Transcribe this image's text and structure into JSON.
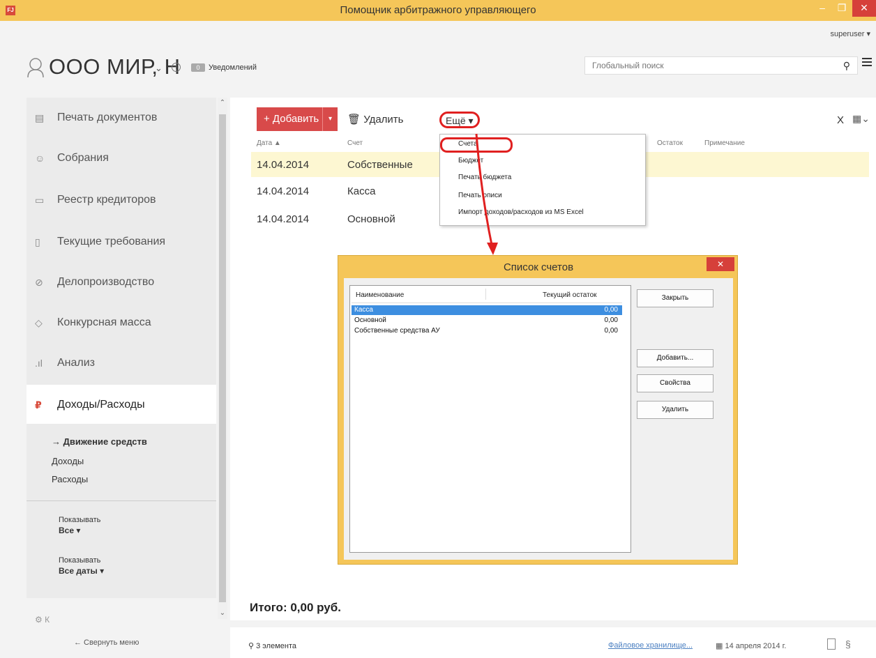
{
  "window": {
    "title": "Помощник арбитражного управляющего",
    "user": "superuser ▾"
  },
  "header": {
    "org_name": "ООО МИР, Н",
    "notifications_count": "0",
    "notifications_label": "Уведомлений",
    "search_placeholder": "Глобальный поиск"
  },
  "sidebar": {
    "items": [
      {
        "label": "Печать документов",
        "icon": "print-icon"
      },
      {
        "label": "Собрания",
        "icon": "meeting-icon"
      },
      {
        "label": "Реестр кредиторов",
        "icon": "registry-icon"
      },
      {
        "label": "Текущие требования",
        "icon": "requirements-icon"
      },
      {
        "label": "Делопроизводство",
        "icon": "paperclip-icon"
      },
      {
        "label": "Конкурсная масса",
        "icon": "assets-icon"
      },
      {
        "label": "Анализ",
        "icon": "chart-icon"
      },
      {
        "label": "Доходы/Расходы",
        "icon": "ruble-icon"
      }
    ],
    "submenu": {
      "active": "→ Движение средств",
      "income": "Доходы",
      "expenses": "Расходы"
    },
    "filters": [
      {
        "label": "Показывать",
        "value": "Все ▾"
      },
      {
        "label": "Показывать",
        "value": "Все даты ▾"
      }
    ],
    "partial_item": "К",
    "collapse_label": "← Свернуть меню"
  },
  "toolbar": {
    "add_label": "+ Добавить",
    "delete_label": "Удалить",
    "more_label": "Ещё ▾"
  },
  "table": {
    "columns": [
      "Дата ▲",
      "Счет",
      "Остаток",
      "Примечание"
    ],
    "rows": [
      {
        "date": "14.04.2014",
        "account": "Собственные"
      },
      {
        "date": "14.04.2014",
        "account": "Касса"
      },
      {
        "date": "14.04.2014",
        "account": "Основной"
      }
    ]
  },
  "dropdown": {
    "items": [
      "Счета",
      "Бюджет",
      "Печать бюджета",
      "Печать описи",
      "Импорт доходов/расходов из MS Excel"
    ]
  },
  "dialog": {
    "title": "Список счетов",
    "columns": [
      "Наименование",
      "Текущий остаток"
    ],
    "rows": [
      {
        "name": "Касса",
        "balance": "0,00"
      },
      {
        "name": "Основной",
        "balance": "0,00"
      },
      {
        "name": "Собственные средства АУ",
        "balance": "0,00"
      }
    ],
    "buttons": {
      "close": "Закрыть",
      "add": "Добавить...",
      "properties": "Свойства",
      "delete": "Удалить"
    }
  },
  "footer": {
    "total": "Итого:  0,00 руб.",
    "count": "3 элемента",
    "storage_link": "Файловое хранилище...",
    "date": "14 апреля 2014 г."
  },
  "colors": {
    "titlebar": "#f5c659",
    "accent_red": "#d84a4a",
    "selection_blue": "#3d8ee0",
    "row_highlight": "#fdf7d2"
  }
}
